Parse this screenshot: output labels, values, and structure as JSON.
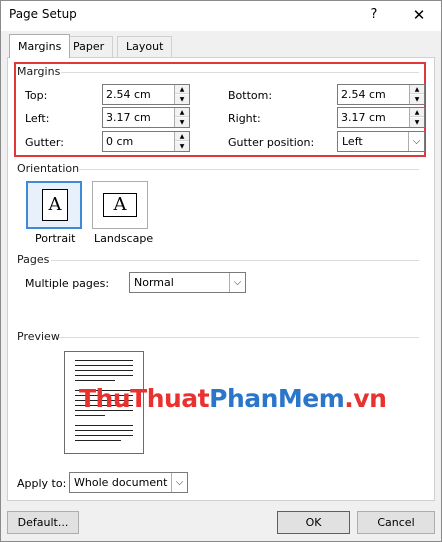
{
  "window": {
    "title": "Page Setup",
    "help": "?",
    "close": "✕"
  },
  "tabs": [
    {
      "label": "Margins"
    },
    {
      "label": "Paper"
    },
    {
      "label": "Layout"
    }
  ],
  "margins": {
    "section": "Margins",
    "top": {
      "label": "Top:",
      "value": "2.54 cm"
    },
    "bottom": {
      "label": "Bottom:",
      "value": "2.54 cm"
    },
    "left": {
      "label": "Left:",
      "value": "3.17 cm"
    },
    "right": {
      "label": "Right:",
      "value": "3.17 cm"
    },
    "gutter": {
      "label": "Gutter:",
      "value": "0 cm"
    },
    "gutter_position": {
      "label": "Gutter position:",
      "value": "Left"
    }
  },
  "orientation": {
    "section": "Orientation",
    "portrait": "Portrait",
    "landscape": "Landscape",
    "icon_letter": "A",
    "selected": "portrait"
  },
  "pages": {
    "section": "Pages",
    "multiple_label": "Multiple pages:",
    "multiple_value": "Normal"
  },
  "preview": {
    "section": "Preview"
  },
  "watermark": {
    "part1": "ThuThuat",
    "part2": "PhanMem",
    "part3": ".vn"
  },
  "apply": {
    "label": "Apply to:",
    "value": "Whole document"
  },
  "buttons": {
    "default": "Default...",
    "ok": "OK",
    "cancel": "Cancel"
  },
  "colors": {
    "highlight_border": "#e0373a",
    "selection": "#3d8ad6",
    "watermark_red": "#e9322f",
    "watermark_blue": "#2b76c9"
  }
}
